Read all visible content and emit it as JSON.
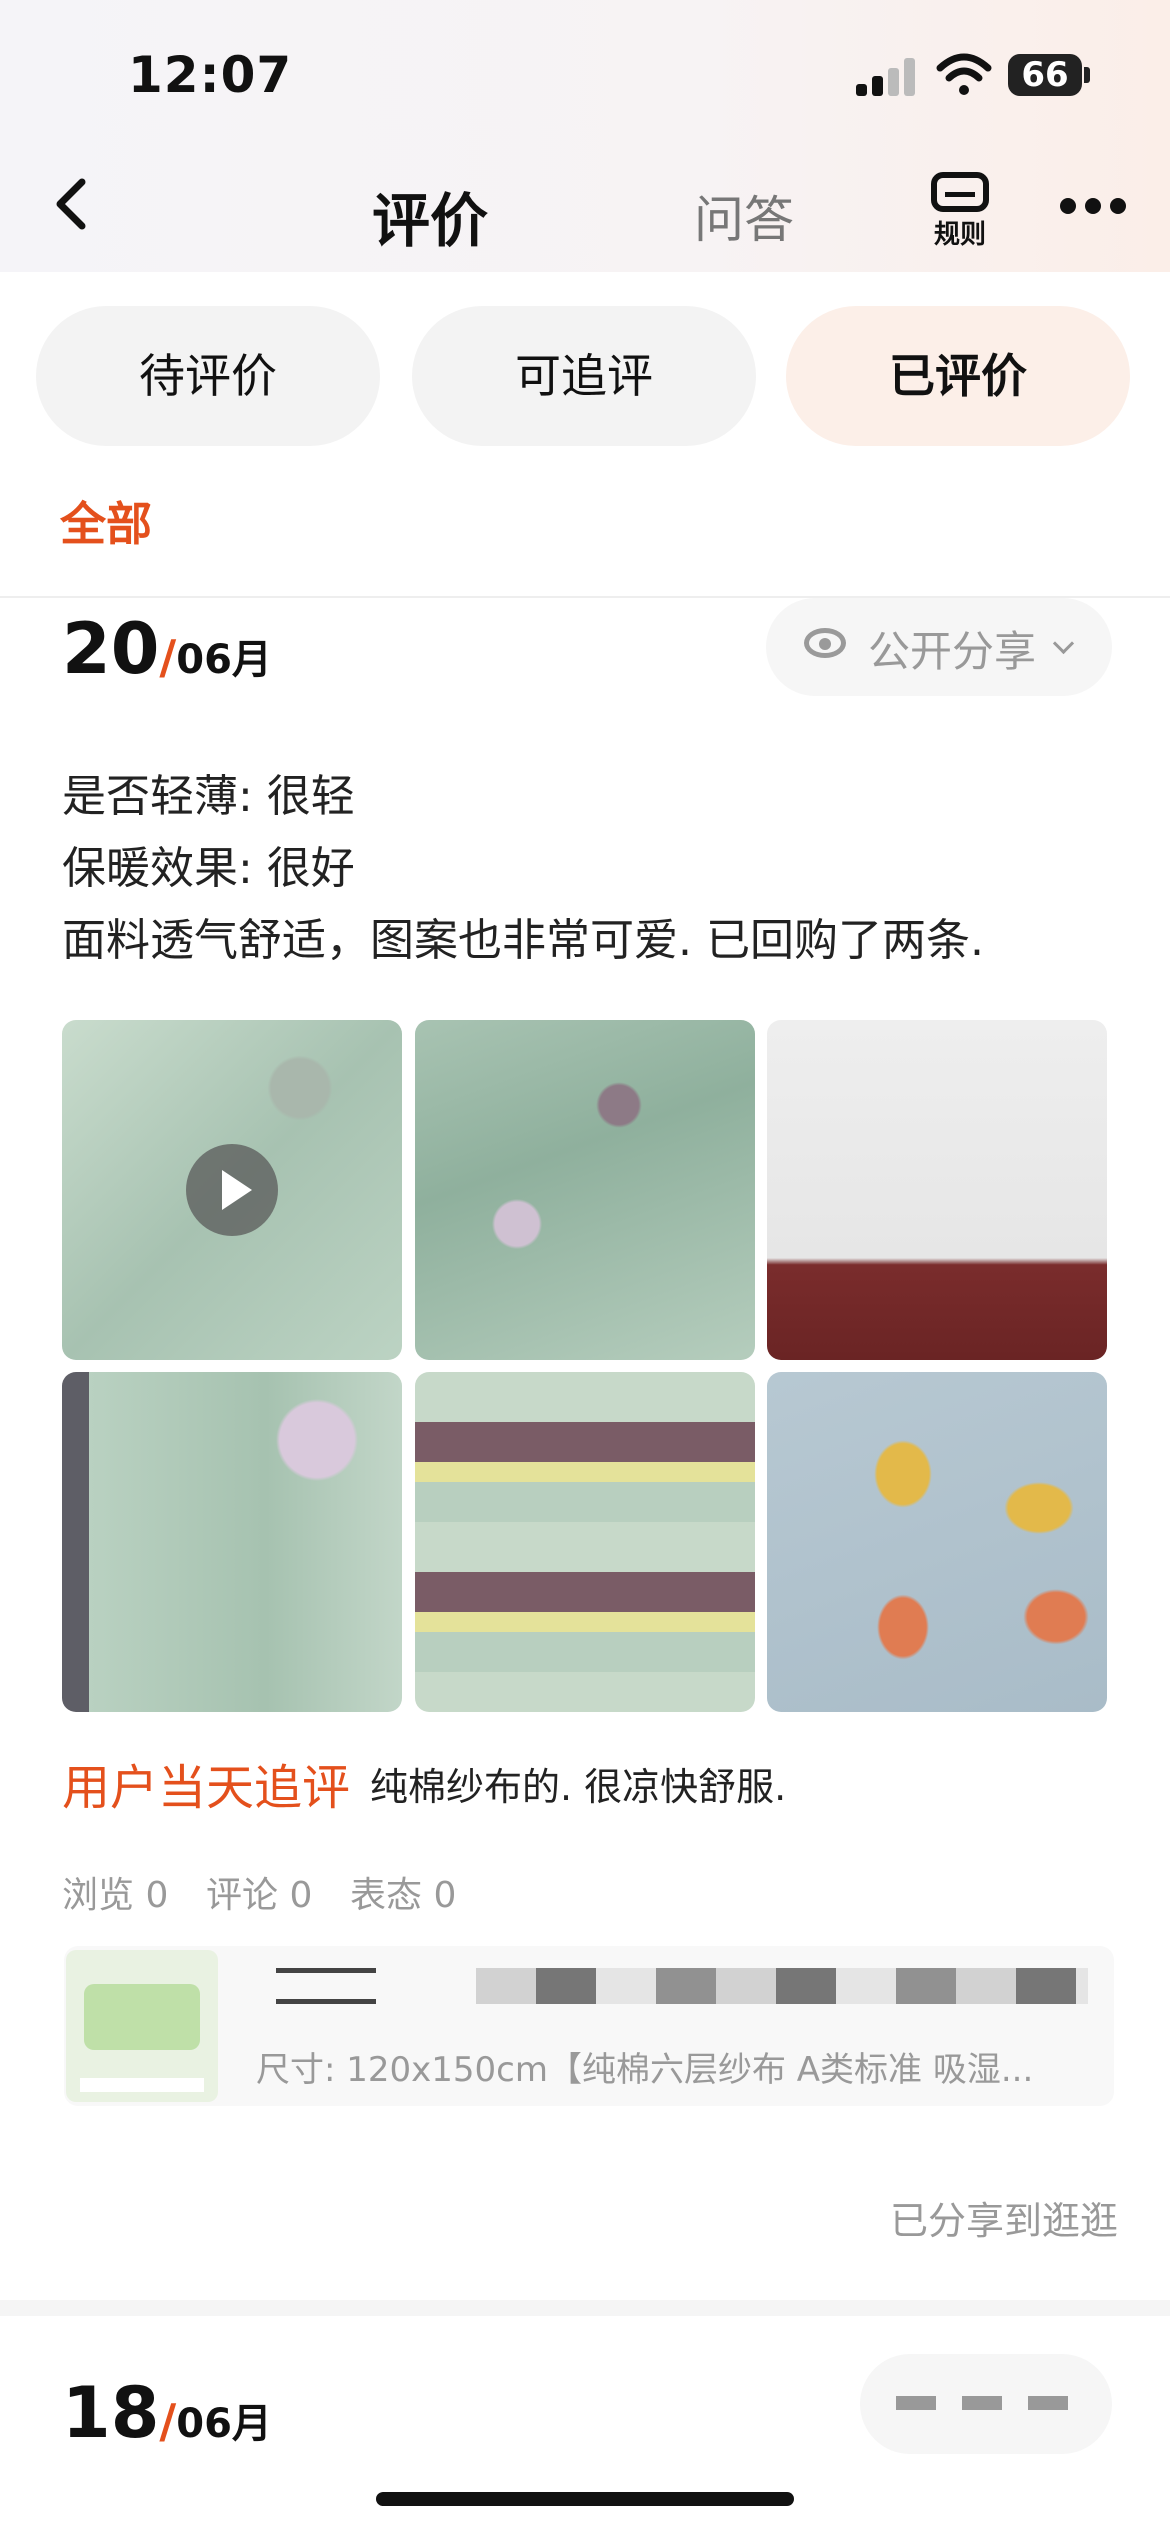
{
  "status_bar": {
    "time": "12:07",
    "battery": "66"
  },
  "nav": {
    "title": "评价",
    "qa": "问答",
    "rules": "规则"
  },
  "tabs": [
    {
      "label": "待评价"
    },
    {
      "label": "可追评"
    },
    {
      "label": "已评价"
    }
  ],
  "filter": {
    "label": "全部"
  },
  "review1": {
    "day": "20",
    "month": "06月",
    "visibility": "公开分享",
    "lines": [
      "是否轻薄: 很轻",
      "保暖效果: 很好",
      "面料透气舒适，图案也非常可爱. 已回购了两条."
    ],
    "followup_label": "用户当天追评",
    "followup_text": "纯棉纱布的. 很凉快舒服.",
    "stats": {
      "views": "浏览 0",
      "comments": "评论 0",
      "reactions": "表态 0"
    },
    "product": {
      "spec": "尺寸: 120x150cm【纯棉六层纱布 A类标准 吸湿..."
    },
    "shared_to": "已分享到逛逛"
  },
  "review2": {
    "day": "18",
    "month": "06月"
  },
  "colors": {
    "accent": "#e4501c",
    "active_tab_bg": "#fcefe8"
  }
}
